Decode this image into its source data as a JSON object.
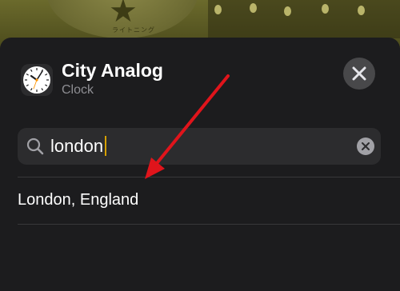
{
  "wallpaper": {
    "sign_text": "ライトニング"
  },
  "widget": {
    "app_name": "City Analog",
    "app_subtitle": "Clock",
    "icon": "analog-clock-icon"
  },
  "close": {
    "icon": "close-x-icon"
  },
  "search": {
    "value": "london",
    "icon": "magnifying-glass-icon",
    "clear_icon": "clear-x-icon"
  },
  "results": [
    {
      "label": "London, England"
    }
  ],
  "annotation": {
    "arrow_color": "#e0141b"
  },
  "colors": {
    "sheet_bg": "#1c1c1e",
    "field_bg": "#2c2c2e",
    "close_bg": "#48484a",
    "caret": "#d6a000",
    "subtitle": "#8e8e93"
  }
}
